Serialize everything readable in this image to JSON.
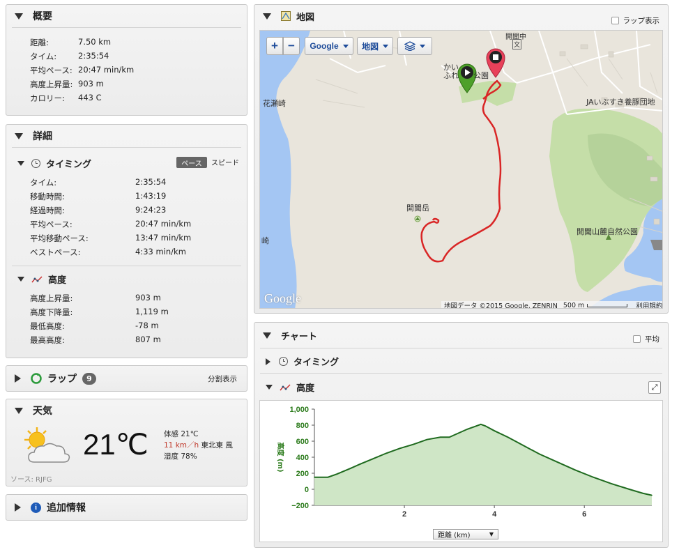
{
  "summary": {
    "title": "概要",
    "rows": [
      {
        "label": "距離:",
        "value": "7.50 km"
      },
      {
        "label": "タイム:",
        "value": "2:35:54"
      },
      {
        "label": "平均ペース:",
        "value": "20:47 min/km"
      },
      {
        "label": "高度上昇量:",
        "value": "903 m"
      },
      {
        "label": "カロリー:",
        "value": "443 C"
      }
    ]
  },
  "details": {
    "title": "詳細",
    "timing": {
      "title": "タイミング",
      "toggle_pace": "ペース",
      "toggle_speed": "スピード",
      "rows": [
        {
          "label": "タイム:",
          "value": "2:35:54"
        },
        {
          "label": "移動時間:",
          "value": "1:43:19"
        },
        {
          "label": "経過時間:",
          "value": "9:24:23"
        },
        {
          "label": "平均ペース:",
          "value": "20:47 min/km"
        },
        {
          "label": "平均移動ペース:",
          "value": "13:47 min/km"
        },
        {
          "label": "ベストペース:",
          "value": "4:33 min/km"
        }
      ]
    },
    "elevation": {
      "title": "高度",
      "rows": [
        {
          "label": "高度上昇量:",
          "value": "903 m"
        },
        {
          "label": "高度下降量:",
          "value": "1,119 m"
        },
        {
          "label": "最低高度:",
          "value": "-78 m"
        },
        {
          "label": "最高高度:",
          "value": "807 m"
        }
      ]
    }
  },
  "laps": {
    "title": "ラップ",
    "count": "9",
    "split_label": "分割表示"
  },
  "weather": {
    "title": "天気",
    "temp": "21℃",
    "feels": "体感 21℃",
    "wind_speed": "11 km／h",
    "wind_dir": "東北東 風",
    "humidity": "湿度 78%",
    "source": "ソース: RJFG"
  },
  "extra": {
    "title": "追加情報"
  },
  "map": {
    "title": "地図",
    "lap_toggle": "ラップ表示",
    "provider_btn": "Google",
    "type_btn": "地図",
    "zoom_in": "+",
    "zoom_out": "−",
    "labels": {
      "kaimondake": "開聞岳",
      "hanase": "花瀬崎",
      "ja": "JAいぶすき養豚団地",
      "park": "開聞山麓自然公園",
      "kaimon_middle": "開聞中",
      "bun": "文",
      "kai": "かい",
      "fure": "ふれ",
      "saki": "崎",
      "park_top": "公園"
    },
    "google_logo": "Google",
    "attribution": "地図データ ©2015 Google, ZENRIN",
    "scale": "500 m",
    "terms": "利用規約"
  },
  "chart_panel": {
    "title": "チャート",
    "avg_toggle": "平均",
    "timing_section": "タイミング",
    "elevation_section": "高度",
    "x_select": "距離 (km)"
  },
  "chart_data": {
    "type": "area",
    "title": "",
    "xlabel": "距離 (km)",
    "ylabel": "高度 (m)",
    "xlim": [
      0,
      7.5
    ],
    "ylim": [
      -200,
      1000
    ],
    "xticks": [
      2,
      4,
      6
    ],
    "yticks": [
      1000,
      800,
      600,
      400,
      200,
      0,
      -200
    ],
    "ytick_labels": [
      "1,000",
      "800",
      "600",
      "400",
      "200",
      "0",
      "−200"
    ],
    "series": [
      {
        "x": [
          0.0,
          0.3,
          0.5,
          0.8,
          1.0,
          1.3,
          1.6,
          1.9,
          2.2,
          2.5,
          2.8,
          3.0,
          3.2,
          3.4,
          3.6,
          3.7,
          3.8,
          4.0,
          4.3,
          4.6,
          5.0,
          5.4,
          5.8,
          6.2,
          6.6,
          7.0,
          7.3,
          7.5
        ],
        "y": [
          150,
          150,
          190,
          260,
          310,
          380,
          450,
          510,
          560,
          620,
          650,
          650,
          700,
          750,
          790,
          810,
          790,
          730,
          650,
          560,
          440,
          340,
          240,
          150,
          70,
          0,
          -50,
          -75
        ]
      }
    ],
    "colors": {
      "line": "#1f6a1f",
      "fill": "#cfe6c6",
      "axis_text": "#2a7a1a"
    }
  }
}
